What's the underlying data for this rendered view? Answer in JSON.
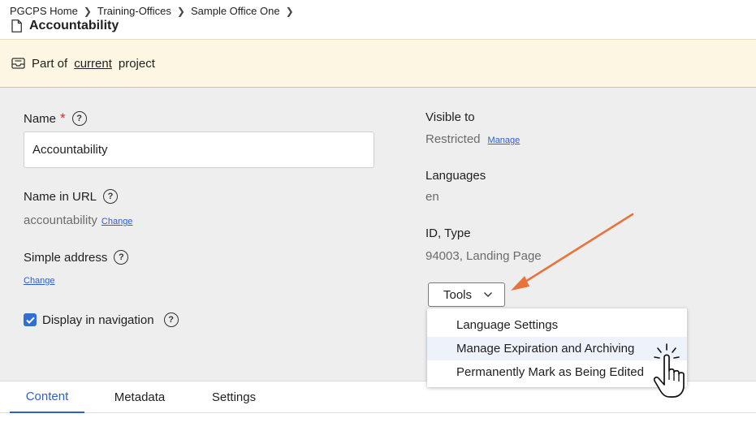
{
  "breadcrumb": [
    "PGCPS Home",
    "Training-Offices",
    "Sample Office One"
  ],
  "page_title": "Accountability",
  "banner": {
    "prefix": "Part of",
    "link": "current",
    "suffix": "project"
  },
  "form": {
    "name_label": "Name",
    "required_mark": "*",
    "name_value": "Accountability",
    "url_label": "Name in URL",
    "url_value": "accountability",
    "change_label": "Change",
    "simple_address_label": "Simple address",
    "simple_address_change": "Change",
    "display_nav_label": "Display in navigation",
    "display_nav_checked": true
  },
  "details": {
    "visible_label": "Visible to",
    "visible_value": "Restricted",
    "manage_label": "Manage",
    "languages_label": "Languages",
    "languages_value": "en",
    "id_type_label": "ID, Type",
    "id_type_value": "94003, Landing Page"
  },
  "tools": {
    "label": "Tools",
    "menu": [
      "Language Settings",
      "Manage Expiration and Archiving",
      "Permanently Mark as Being Edited"
    ],
    "hovered_index": 1
  },
  "tabs": [
    "Content",
    "Metadata",
    "Settings"
  ],
  "active_tab": 0,
  "icons": [
    "document-icon",
    "inbox-icon",
    "help-circle-icon",
    "checkmark-icon",
    "chevron-down-icon",
    "chevron-right-icon",
    "hand-pointer-icon"
  ],
  "colors": {
    "accent": "#2d5fd0",
    "required": "#d62a2a",
    "banner_bg": "#fdf6e3",
    "panel_bg": "#eeeeee",
    "annotation_arrow": "#e8743b"
  }
}
